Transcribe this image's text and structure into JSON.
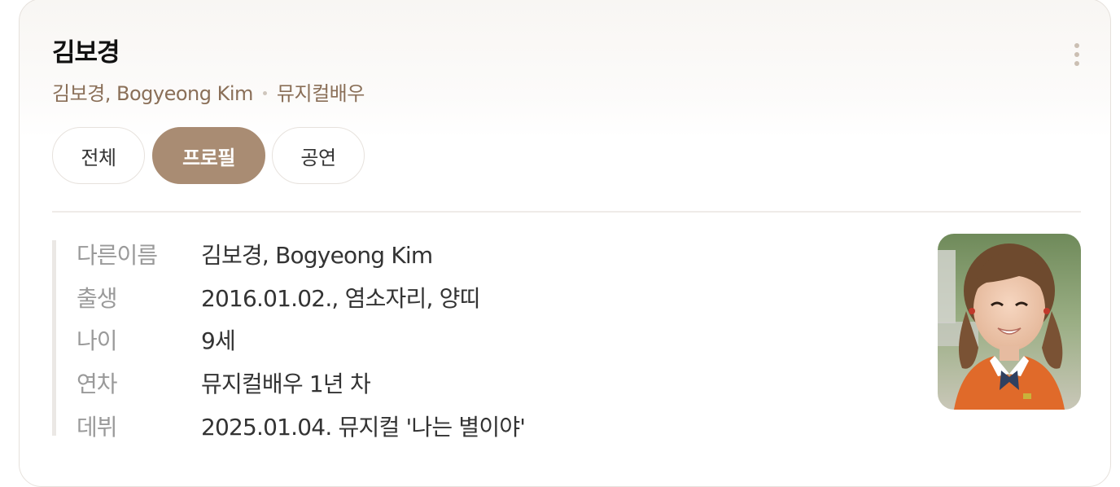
{
  "header": {
    "title": "김보경",
    "alt_names": "김보경, Bogyeong Kim",
    "occupation": "뮤지컬배우"
  },
  "tabs": [
    {
      "label": "전체",
      "active": false
    },
    {
      "label": "프로필",
      "active": true
    },
    {
      "label": "공연",
      "active": false
    }
  ],
  "profile": {
    "rows": [
      {
        "label": "다른이름",
        "value": "김보경, Bogyeong Kim"
      },
      {
        "label": "출생",
        "value": "2016.01.02., 염소자리, 양띠"
      },
      {
        "label": "나이",
        "value": "9세"
      },
      {
        "label": "연차",
        "value": "뮤지컬배우 1년 차"
      },
      {
        "label": "데뷔",
        "value": "2025.01.04. 뮤지컬 '나는 별이야'"
      }
    ]
  },
  "colors": {
    "accent": "#a98c73",
    "subtitle": "#8a6f58",
    "label": "#9a9a9a"
  },
  "icons": {
    "more": "more-vertical-icon"
  }
}
